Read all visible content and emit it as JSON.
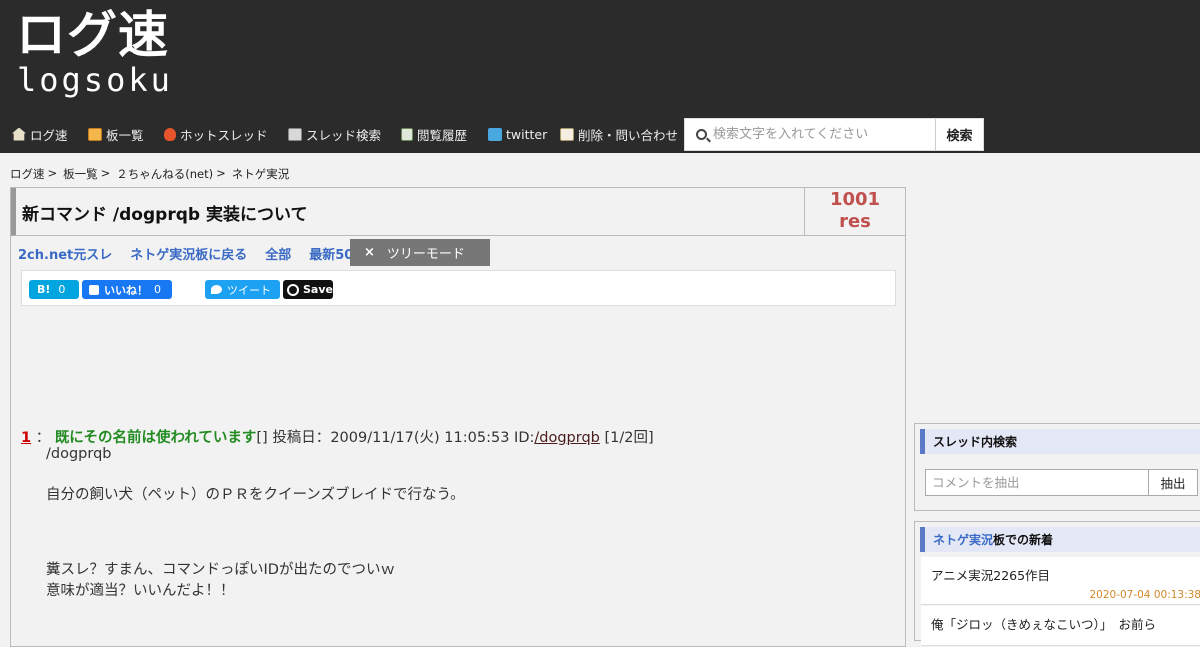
{
  "logo": {
    "jp": "ログ速",
    "en": "logsoku"
  },
  "nav": [
    {
      "label": "ログ速",
      "icon": "home-icon"
    },
    {
      "label": "板一覧",
      "icon": "board-icon"
    },
    {
      "label": "ホットスレッド",
      "icon": "fire-icon"
    },
    {
      "label": "スレッド検索",
      "icon": "thread-search-icon"
    },
    {
      "label": "閲覧履歴",
      "icon": "history-icon"
    },
    {
      "label": "twitter",
      "icon": "twitter-icon"
    },
    {
      "label": "削除・問い合わせ",
      "icon": "mail-icon"
    }
  ],
  "search": {
    "placeholder": "検索文字を入れてください",
    "button": "検索"
  },
  "breadcrumb": [
    "ログ速",
    "板一覧",
    "２ちゃんねる(net)",
    "ネトゲ実況"
  ],
  "breadcrumb_sep": ">",
  "thread": {
    "title": "新コマンド /dogprqb 実装について",
    "res_count": "1001",
    "res_label": "res"
  },
  "links": [
    "2ch.net元スレ",
    "ネトゲ実況板に戻る",
    "全部",
    "最新50"
  ],
  "tree_mode": {
    "icon": "×",
    "label": "ツリーモード"
  },
  "share": {
    "hatena": {
      "label": "B!",
      "count": "0"
    },
    "facebook": {
      "label": "いいね！",
      "count": "0"
    },
    "tweet": {
      "label": "ツイート"
    },
    "pinterest": {
      "label": "Save"
    }
  },
  "post": {
    "num": "1",
    "colon": "：",
    "name": "既にその名前は使われています",
    "bracket": "[]",
    "date_prefix": "投稿日：",
    "date": "2009/11/17(火) 11:05:53",
    "id_prefix": "ID:",
    "id": "/dogprqb",
    "count": "[1/2回]",
    "lines": [
      "/dogprqb",
      "自分の飼い犬（ペット）のＰＲをクイーンズブレイドで行なう。",
      "糞スレ？すまん、コマンドっぽいIDが出たのでついｗ",
      "意味が適当？いいんだよ！！"
    ]
  },
  "sidebar": {
    "search_title": "スレッド内検索",
    "filter_placeholder": "コメントを抽出",
    "filter_button": "抽出",
    "news_board": "ネトゲ実況",
    "news_suffix": "板での新着",
    "news": [
      {
        "title": "アニメ実況2265作目",
        "date": "2020-07-04 00:13:38"
      },
      {
        "title": "俺「ジロッ（きめぇなこいつ）」　お前ら",
        "date": ""
      }
    ]
  }
}
